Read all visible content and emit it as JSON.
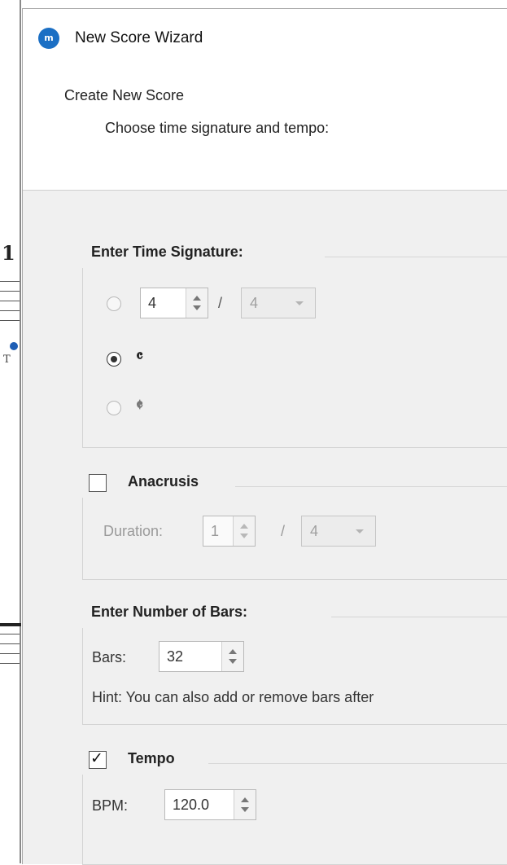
{
  "background_score": {
    "measure_number": "1",
    "text_fragment": "T"
  },
  "window": {
    "app_icon": "musescore-icon",
    "app_icon_text": "m",
    "title": "New Score Wizard"
  },
  "header": {
    "title": "Create New Score",
    "subtitle": "Choose time signature and tempo:"
  },
  "time_signature": {
    "group_title": "Enter Time Signature:",
    "custom_numerator": "4",
    "separator": "/",
    "custom_denominator": "4",
    "common_time_symbol": "𝄴",
    "cut_time_symbol": "𝄵",
    "selected_option": "common_time"
  },
  "anacrusis": {
    "label": "Anacrusis",
    "checked": false,
    "duration_label": "Duration:",
    "duration_numerator": "1",
    "separator": "/",
    "duration_denominator": "4"
  },
  "bars": {
    "group_title": "Enter Number of Bars:",
    "label": "Bars:",
    "value": "32",
    "hint": "Hint: You can also add or remove bars after"
  },
  "tempo": {
    "label": "Tempo",
    "checked": true,
    "check_mark": "✓",
    "bpm_label": "BPM:",
    "bpm_value": "120.0"
  },
  "colors": {
    "dialog_bg": "#f0f0f0",
    "icon_blue": "#1b6fc4",
    "disabled_text": "#9a9a9a"
  }
}
